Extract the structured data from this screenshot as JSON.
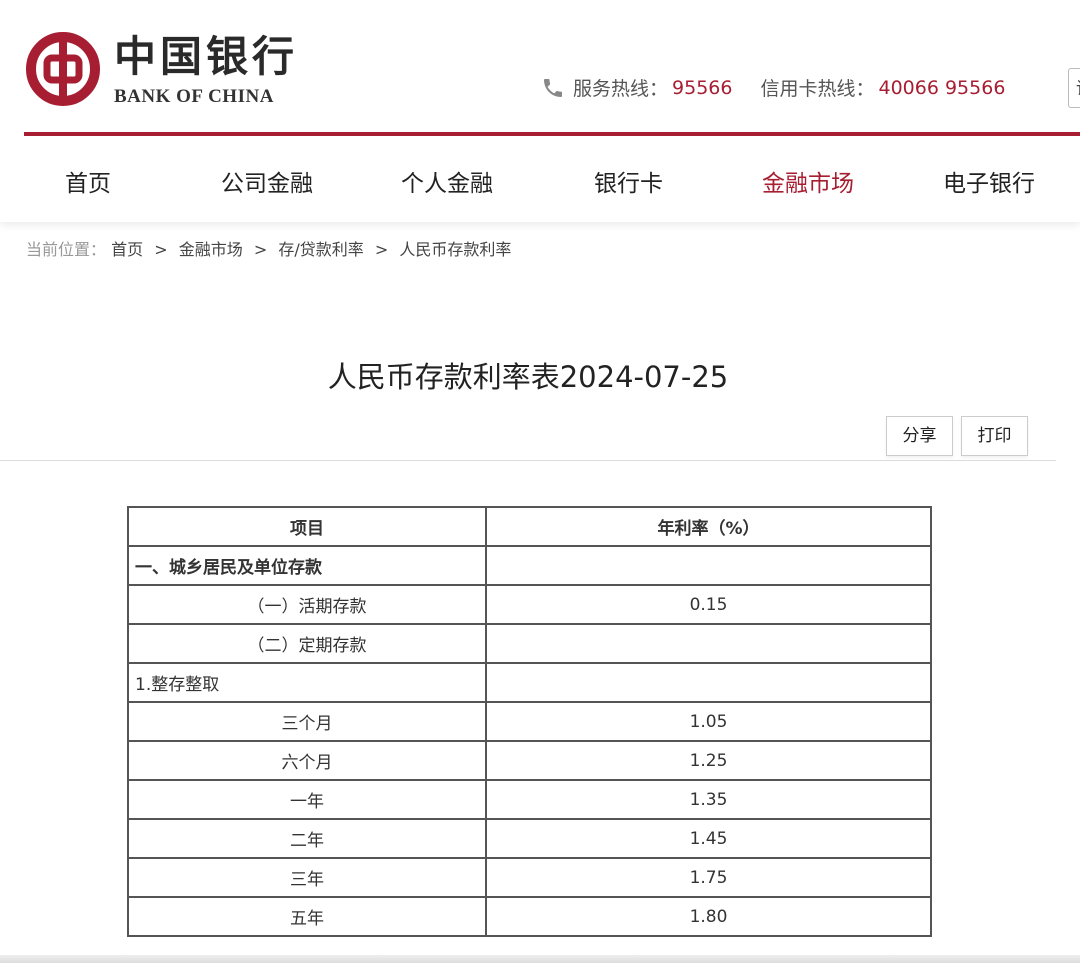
{
  "brand": {
    "name_cn": "中国银行",
    "name_en": "BANK OF CHINA",
    "color": "#a71e32",
    "logo_icon": "bank-of-china-logo"
  },
  "hotlines": {
    "icon": "phone-icon",
    "service_label": "服务热线：",
    "service_number": "95566",
    "credit_label": "信用卡热线：",
    "credit_number": "40066 95566",
    "right_box_text": "请"
  },
  "nav": {
    "items": [
      {
        "label": "首页"
      },
      {
        "label": "公司金融"
      },
      {
        "label": "个人金融"
      },
      {
        "label": "银行卡"
      },
      {
        "label": "金融市场"
      },
      {
        "label": "电子银行"
      }
    ],
    "active_index": 4
  },
  "breadcrumb": {
    "prefix": "当前位置：",
    "items": [
      "首页",
      "金融市场",
      "存/贷款利率",
      "人民币存款利率"
    ],
    "separator": ">"
  },
  "page": {
    "title": "人民币存款利率表2024-07-25",
    "share_label": "分享",
    "print_label": "打印"
  },
  "table": {
    "headers": [
      "项目",
      "年利率（%）"
    ],
    "rows": [
      {
        "item": "一、城乡居民及单位存款",
        "rate": "",
        "style": "left-bold"
      },
      {
        "item": "（一）活期存款",
        "rate": "0.15",
        "style": "center"
      },
      {
        "item": "（二）定期存款",
        "rate": "",
        "style": "center"
      },
      {
        "item": "1.整存整取",
        "rate": "",
        "style": "left"
      },
      {
        "item": "三个月",
        "rate": "1.05",
        "style": "center"
      },
      {
        "item": "六个月",
        "rate": "1.25",
        "style": "center"
      },
      {
        "item": "一年",
        "rate": "1.35",
        "style": "center"
      },
      {
        "item": "二年",
        "rate": "1.45",
        "style": "center"
      },
      {
        "item": "三年",
        "rate": "1.75",
        "style": "center"
      },
      {
        "item": "五年",
        "rate": "1.80",
        "style": "center"
      }
    ]
  }
}
